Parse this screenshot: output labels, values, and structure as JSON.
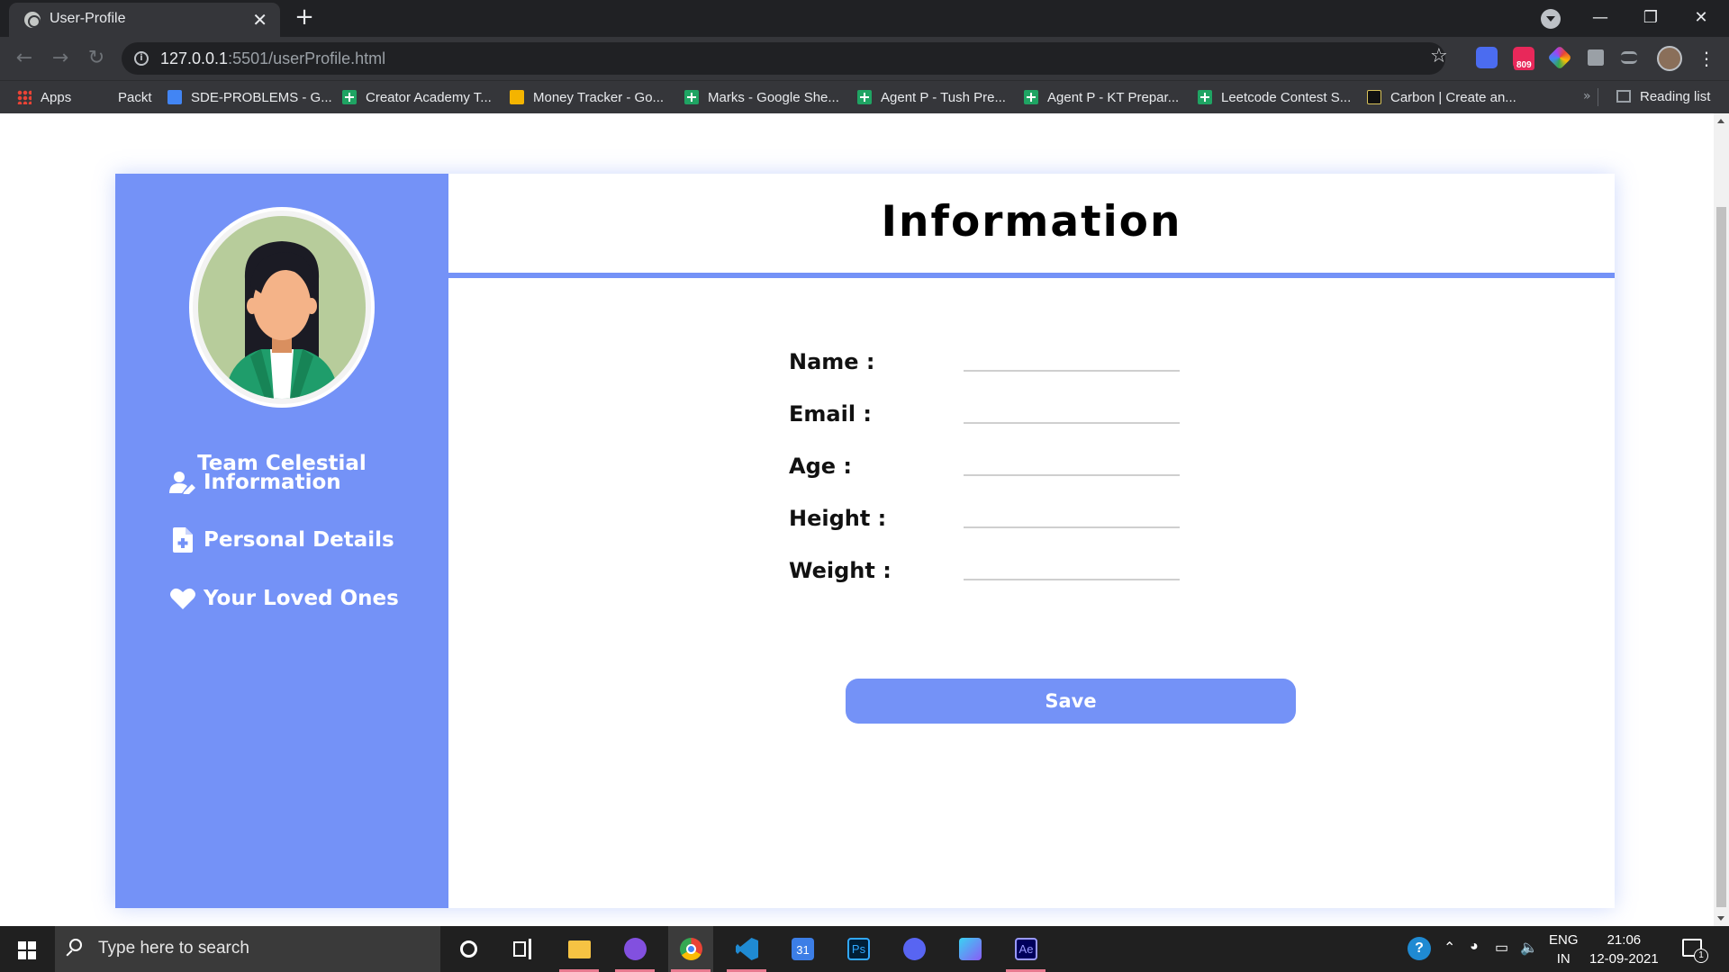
{
  "browser": {
    "tab_title": "User-Profile",
    "tab_close": "✕",
    "new_tab": "+",
    "url_host": "127.0.0.1",
    "url_rest": ":5501/userProfile.html",
    "extension_badge": "809",
    "bookmarks": [
      {
        "label": "Apps",
        "icon": "apps-grid-icon"
      },
      {
        "label": "Packt",
        "icon": "none"
      },
      {
        "label": "SDE-PROBLEMS - G...",
        "icon": "google-docs-icon"
      },
      {
        "label": "Creator Academy T...",
        "icon": "google-sheets-icon"
      },
      {
        "label": "Money Tracker - Go...",
        "icon": "google-slides-icon"
      },
      {
        "label": "Marks - Google She...",
        "icon": "google-sheets-icon"
      },
      {
        "label": "Agent P - Tush Pre...",
        "icon": "google-sheets-icon"
      },
      {
        "label": "Agent P - KT Prepar...",
        "icon": "google-sheets-icon"
      },
      {
        "label": "Leetcode Contest S...",
        "icon": "google-sheets-icon"
      },
      {
        "label": "Carbon | Create an...",
        "icon": "carbon-icon"
      }
    ],
    "overflow": "»",
    "reading_list": "Reading list"
  },
  "sidebar": {
    "team_name": "Team Celestial",
    "nav": [
      {
        "label": "Information",
        "icon": "user-edit-icon"
      },
      {
        "label": "Personal Details",
        "icon": "file-plus-icon"
      },
      {
        "label": "Your Loved Ones",
        "icon": "heart-icon"
      }
    ]
  },
  "main": {
    "heading": "Information",
    "fields": [
      {
        "label": "Name :",
        "value": ""
      },
      {
        "label": "Email :",
        "value": ""
      },
      {
        "label": "Age :",
        "value": ""
      },
      {
        "label": "Height :",
        "value": ""
      },
      {
        "label": "Weight :",
        "value": ""
      }
    ],
    "save_label": "Save"
  },
  "taskbar": {
    "search_placeholder": "Type here to search",
    "lang_top": "ENG",
    "lang_bottom": "IN",
    "time": "21:06",
    "date": "12-09-2021",
    "notification_count": "1"
  },
  "colors": {
    "accent": "#7492f7",
    "browser_dark": "#202124",
    "browser_toolbar": "#35363a",
    "taskbar": "#202020"
  }
}
